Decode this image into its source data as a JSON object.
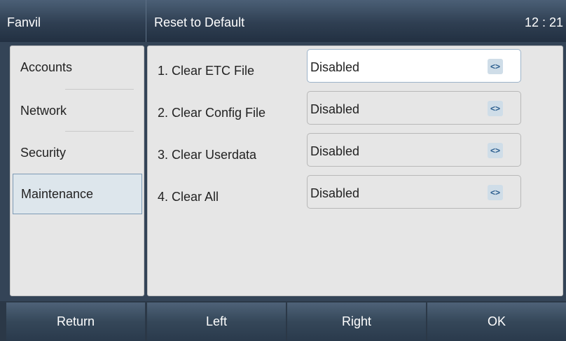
{
  "header": {
    "app_name": "Fanvil",
    "title": "Reset to Default",
    "time": "12 : 21"
  },
  "sidebar": {
    "items": [
      {
        "label": "Accounts"
      },
      {
        "label": "Network"
      },
      {
        "label": "Security"
      },
      {
        "label": "Maintenance",
        "selected": true
      }
    ]
  },
  "content": {
    "rows": [
      {
        "label": "1. Clear ETC File",
        "value": "Disabled",
        "focused": true
      },
      {
        "label": "2. Clear Config File",
        "value": "Disabled"
      },
      {
        "label": "3. Clear Userdata",
        "value": "Disabled"
      },
      {
        "label": "4. Clear All",
        "value": "Disabled"
      }
    ],
    "selector_glyph": "<>"
  },
  "softkeys": [
    {
      "label": "Return"
    },
    {
      "label": "Left"
    },
    {
      "label": "Right"
    },
    {
      "label": "OK"
    }
  ],
  "colors": {
    "header_bg": "#2f3f52",
    "panel_bg": "#e6e6e6",
    "selected_bg": "#dde6ec",
    "selected_border": "#7d9ab5",
    "selector_icon": "#2a5d8e"
  }
}
